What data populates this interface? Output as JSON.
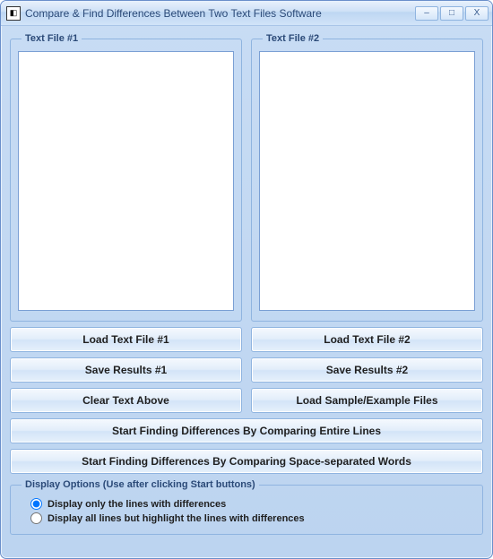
{
  "window": {
    "title": "Compare & Find Differences Between Two Text Files Software"
  },
  "panels": {
    "left_legend": "Text File #1",
    "right_legend": "Text File #2",
    "left_value": "",
    "right_value": ""
  },
  "buttons": {
    "load1": "Load Text File #1",
    "load2": "Load Text File #2",
    "save1": "Save Results #1",
    "save2": "Save Results #2",
    "clear": "Clear Text Above",
    "sample": "Load Sample/Example Files",
    "start_lines": "Start Finding Differences By Comparing Entire Lines",
    "start_words": "Start Finding Differences By Comparing Space-separated Words"
  },
  "options": {
    "legend": "Display Options (Use after clicking Start buttons)",
    "opt1": "Display only the lines with differences",
    "opt2": "Display all lines but highlight the lines with differences",
    "selected": "opt1"
  },
  "icons": {
    "minimize": "–",
    "maximize": "□",
    "close": "X",
    "app": "◧"
  }
}
